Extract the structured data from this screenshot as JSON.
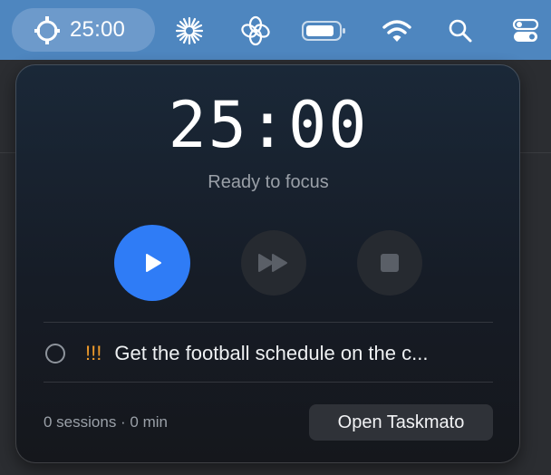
{
  "menubar": {
    "timer_text": "25:00",
    "icons": [
      "perplexity-icon",
      "chatgpt-icon",
      "battery-icon",
      "wifi-icon",
      "spotlight-search-icon",
      "control-center-icon"
    ]
  },
  "popover": {
    "time": "25:00",
    "status": "Ready to focus",
    "controls": [
      "play",
      "skip",
      "stop"
    ],
    "task": {
      "priority": "!!!",
      "title": "Get the football schedule on the c..."
    },
    "stats": "0 sessions · 0 min",
    "open_button": "Open Taskmato"
  },
  "colors": {
    "menubar": "#4e86bf",
    "accent_play": "#2f7cf6",
    "priority": "#ee9a2b"
  }
}
